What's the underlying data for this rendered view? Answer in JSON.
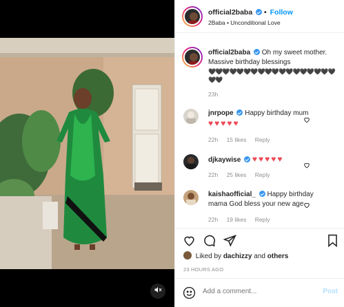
{
  "header": {
    "username": "official2baba",
    "follow_label": "Follow",
    "separator": "•",
    "subtitle": "2Baba • Unconditional Love"
  },
  "caption": {
    "username": "official2baba",
    "text": "Oh my sweet mother. Massive birthday blessings",
    "hearts": "🖤🖤🖤🖤🖤🖤🖤🖤🖤🖤🖤🖤🖤🖤🖤🖤🖤🖤🖤🖤",
    "time": "23h"
  },
  "comments": [
    {
      "username": "jnrpope",
      "text": "Happy birthday mum",
      "hearts": "♥♥♥♥♥",
      "time": "22h",
      "likes": "15 likes",
      "reply": "Reply"
    },
    {
      "username": "djkaywise",
      "text": "",
      "hearts": "♥♥♥♥♥",
      "time": "22h",
      "likes": "25 likes",
      "reply": "Reply"
    },
    {
      "username": "kaishaofficial_",
      "text": "Happy birthday mama God bless your new age",
      "hearts": "",
      "time": "22h",
      "likes": "19 likes",
      "reply": "Reply"
    }
  ],
  "actions": {
    "liked_prefix": "Liked by",
    "liked_user": "dachizzy",
    "liked_suffix": "and",
    "liked_others": "others",
    "posted_ago": "23 HOURS AGO"
  },
  "add_comment": {
    "placeholder": "Add a comment...",
    "post_label": "Post"
  },
  "colors": {
    "accent": "#0095f6",
    "verified": "#3897f0",
    "heart_red": "#ed4956",
    "muted": "#8e8e8e"
  },
  "icons": [
    "heart-icon",
    "comment-icon",
    "share-icon",
    "bookmark-icon",
    "emoji-icon",
    "mute-icon",
    "verified-badge-icon"
  ]
}
